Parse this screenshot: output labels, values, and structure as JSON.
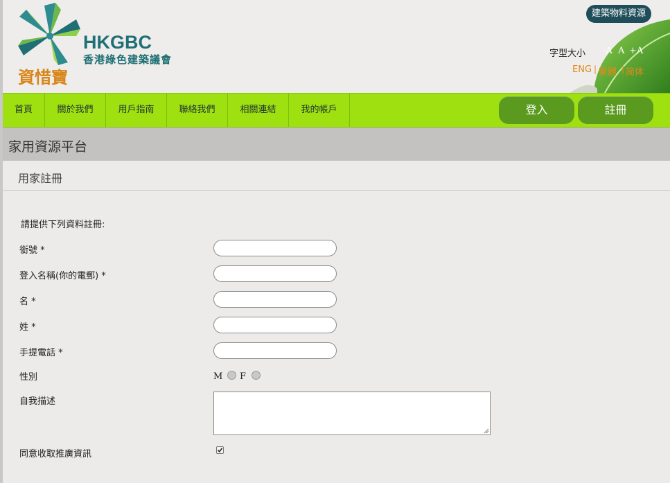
{
  "header": {
    "brand_en": "HKGBC",
    "brand_zh": "香港綠色建築議會",
    "app_name": "資惜寶",
    "top_button": "建築物料資源",
    "font_size_label": "字型大小",
    "font_size_buttons": [
      "-A",
      "A",
      "+A"
    ],
    "languages": [
      "ENG",
      "繁體",
      "简体"
    ],
    "lang_separator": "|"
  },
  "nav": {
    "items": [
      "首頁",
      "關於我們",
      "用戶指南",
      "聯絡我們",
      "相關連結",
      "我的帳戶"
    ],
    "login": "登入",
    "register": "註冊"
  },
  "page": {
    "title": "家用資源平台",
    "subtitle": "用家註冊"
  },
  "form": {
    "intro": "請提供下列資料註冊:",
    "fields": {
      "salutation": {
        "label": "銜號 *",
        "value": ""
      },
      "login_email": {
        "label": "登入名稱(你的電郵) *",
        "value": ""
      },
      "first_name": {
        "label": "名 *",
        "value": ""
      },
      "last_name": {
        "label": "姓 *",
        "value": ""
      },
      "mobile": {
        "label": "手提電話 *",
        "value": ""
      }
    },
    "gender": {
      "label": "性別",
      "options": [
        "M",
        "F"
      ],
      "selected": ""
    },
    "description": {
      "label": "自我描述",
      "value": ""
    },
    "consent": {
      "label": "同意收取推廣資訊",
      "checked": true
    }
  },
  "colors": {
    "nav_green": "#9ee010",
    "pill_green": "#5a9a1e",
    "brand_teal": "#1f6f74",
    "orange": "#d8861a",
    "title_bar": "#c4c2c0"
  }
}
